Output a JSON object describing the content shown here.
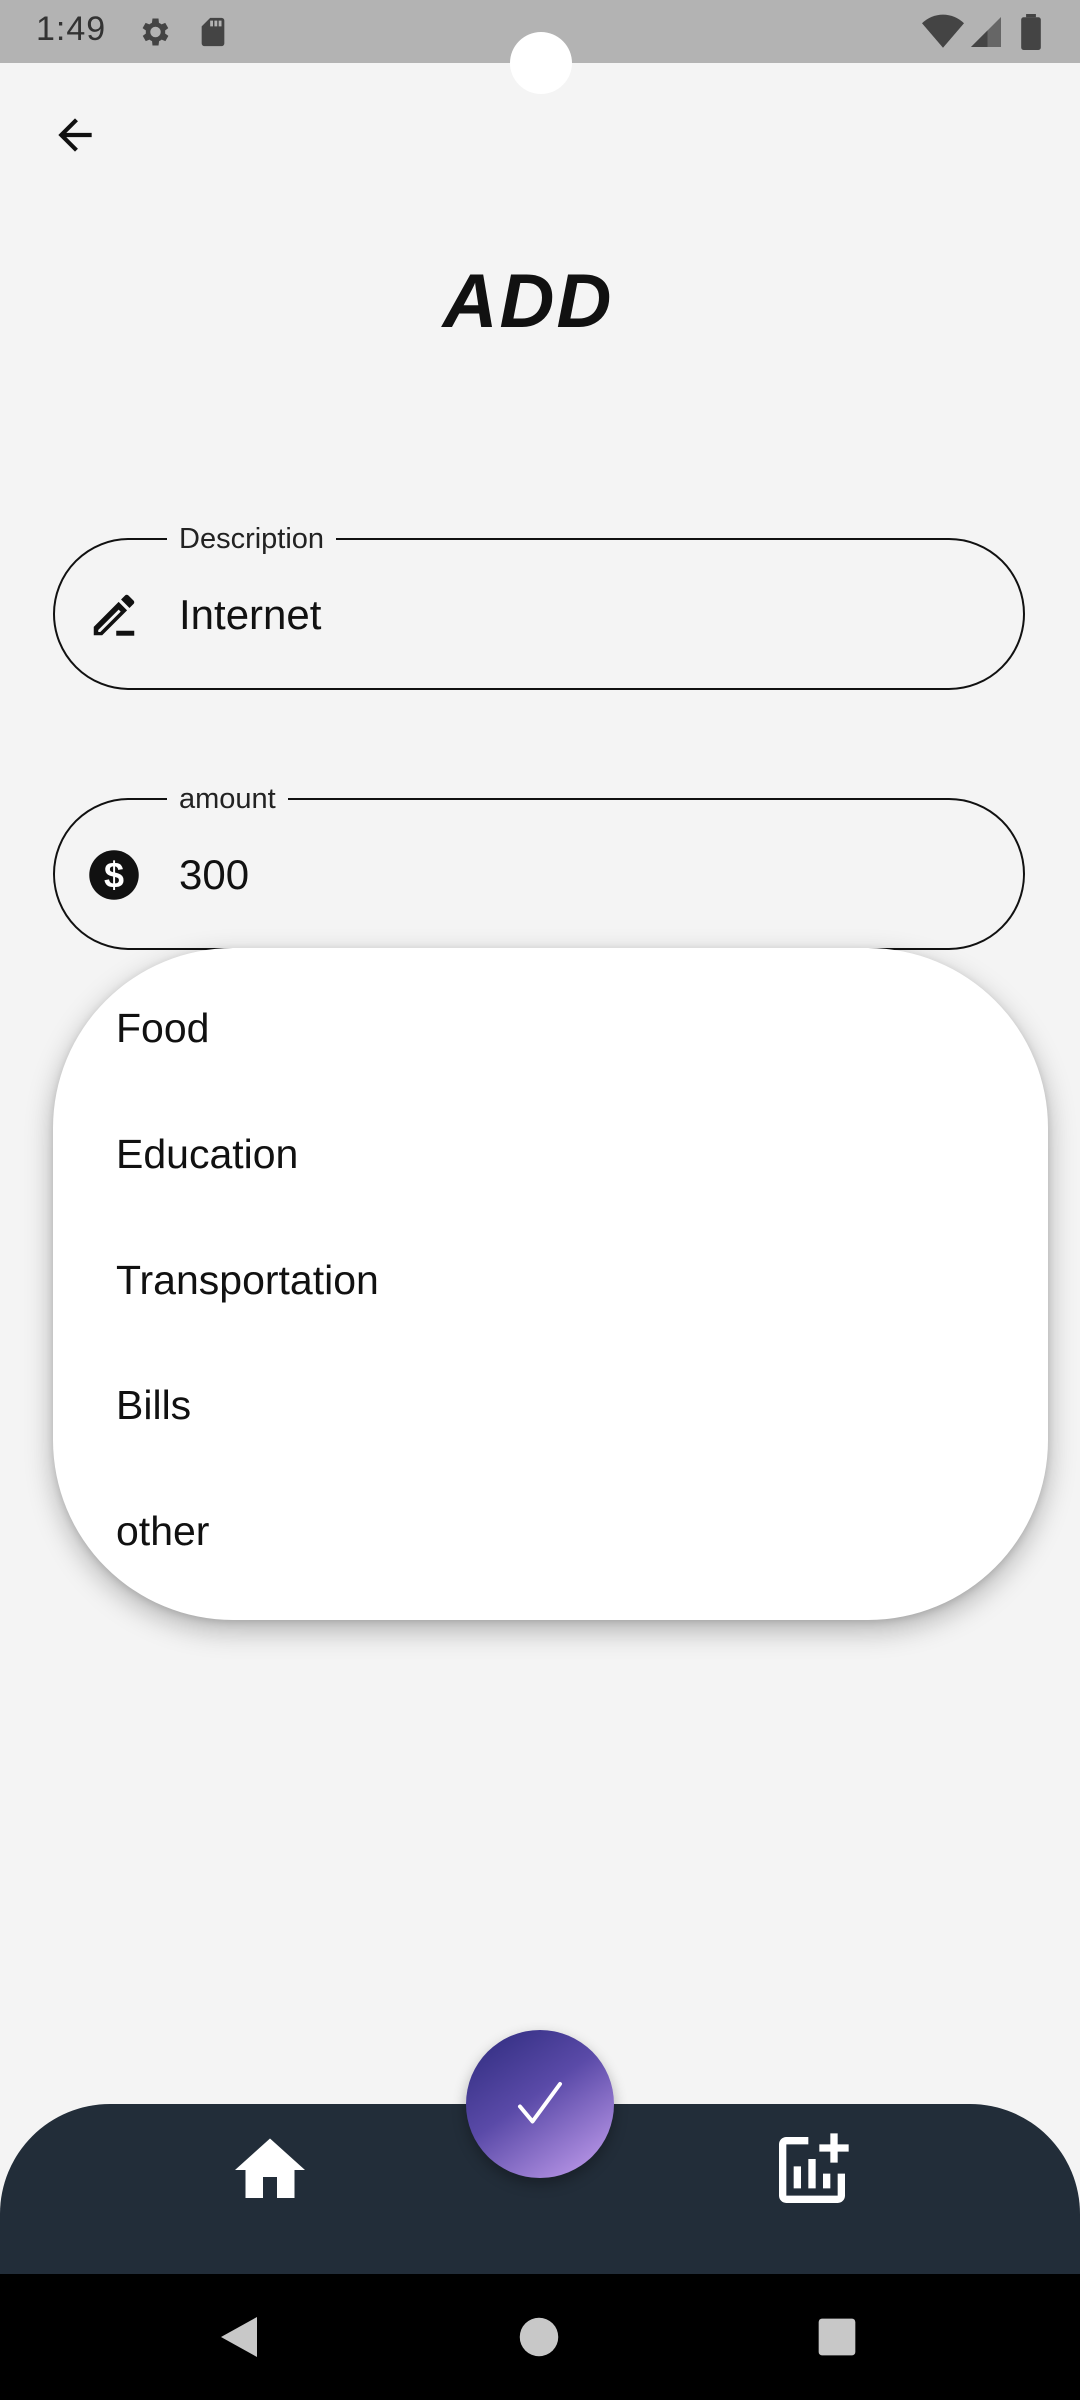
{
  "status_bar": {
    "time": "1:49",
    "icons": [
      "gear-icon",
      "sd-card-icon",
      "wifi-icon",
      "signal-icon",
      "battery-icon"
    ]
  },
  "header": {
    "back_icon": "arrow-left-icon",
    "title": "ADD"
  },
  "form": {
    "description": {
      "label": "Description",
      "value": "Internet",
      "icon": "pen-icon"
    },
    "amount": {
      "label": "amount",
      "value": "300",
      "icon": "dollar-circle-icon"
    }
  },
  "dropdown": {
    "options": [
      "Food",
      "Education",
      "Transportation",
      "Bills",
      "other"
    ]
  },
  "bottom_nav": {
    "home_icon": "home-icon",
    "fab_icon": "check-icon",
    "add_chart_icon": "add-chart-icon",
    "bar_color": "#222d39",
    "fab_gradient": [
      "#2c2a7c",
      "#c9a3f2"
    ]
  },
  "system_nav": {
    "icons": [
      "back-triangle-icon",
      "home-circle-icon",
      "recents-square-icon"
    ]
  }
}
